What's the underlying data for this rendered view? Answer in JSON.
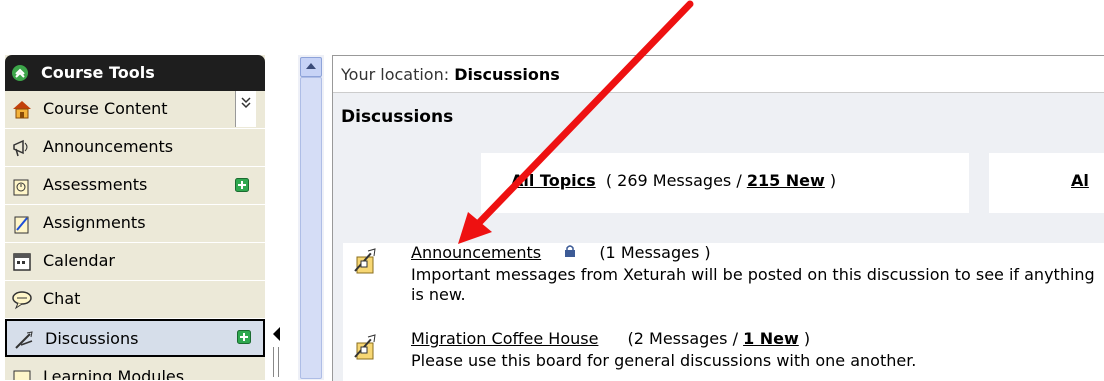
{
  "sidebar": {
    "header": "Course Tools",
    "items": [
      {
        "label": "Course Content",
        "icon": "home-icon"
      },
      {
        "label": "Announcements",
        "icon": "megaphone-icon"
      },
      {
        "label": "Assessments",
        "icon": "assessment-icon",
        "new": true
      },
      {
        "label": "Assignments",
        "icon": "assignment-icon"
      },
      {
        "label": "Calendar",
        "icon": "calendar-icon"
      },
      {
        "label": "Chat",
        "icon": "chat-bubble-icon"
      },
      {
        "label": "Discussions",
        "icon": "discussion-icon",
        "new": true,
        "active": true
      },
      {
        "label": "Learning Modules",
        "icon": "module-icon"
      }
    ]
  },
  "location": {
    "prefix": "Your location:",
    "current": "Discussions"
  },
  "main": {
    "title": "Discussions",
    "all_topics_label": "All Topics",
    "all_topics_open": "( 269 Messages /",
    "all_topics_new": "215 New",
    "all_topics_close": ")",
    "second_tab_partial": "Al"
  },
  "forums": [
    {
      "title": "Announcements",
      "counts": "(1 Messages )",
      "locked": true,
      "description": "Important messages from Xeturah will be posted on this discussion to see if anything is new."
    },
    {
      "title": "Migration Coffee House",
      "counts_open": "(2 Messages /",
      "counts_new": "1 New",
      "counts_close": ")",
      "description": "Please use this board for general discussions with one another."
    }
  ],
  "colors": {
    "annotation_arrow": "#ee1111",
    "sidebar_bg": "#ece9d8",
    "new_badge": "#2fa84f"
  }
}
